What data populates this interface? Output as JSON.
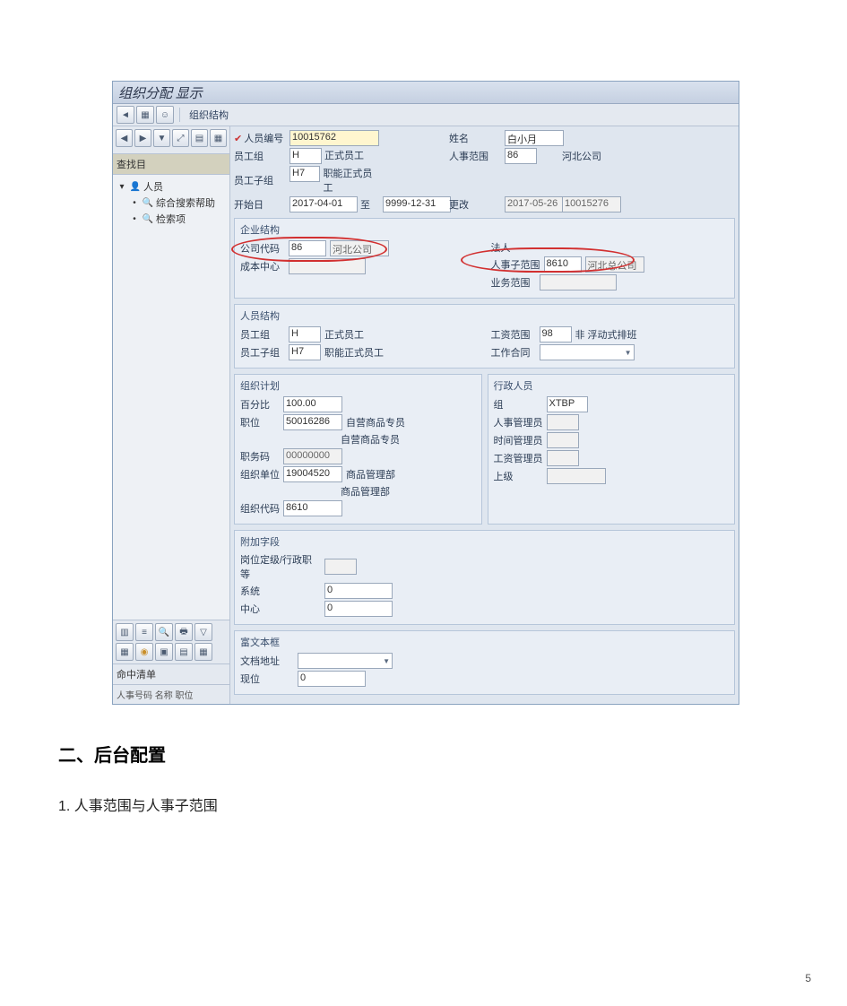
{
  "titlebar": "组织分配 显示",
  "toolbar": {
    "structure": "组织结构"
  },
  "left": {
    "search_title": "查找目",
    "person": "人员",
    "tree_a": "综合搜索帮助",
    "tree_b": "检索项",
    "btm_label": "命中清单",
    "btm_sub": "人事号码 名称 职位"
  },
  "hdr": {
    "person_no_lbl": "人员编号",
    "person_no": "10015762",
    "name_lbl": "姓名",
    "name": "白小月",
    "eggrp_lbl": "员工组",
    "eggrp_code": "H",
    "eggrp_text": "正式员工",
    "area_lbl": "人事范围",
    "area_code": "86",
    "area_text": "河北公司",
    "esub_lbl": "员工子组",
    "esub_code": "H7",
    "esub_text": "职能正式员工",
    "start_lbl": "开始日",
    "start": "2017-04-01",
    "to": "至",
    "end": "9999-12-31",
    "chg_lbl": "更改",
    "chg_date": "2017-05-26",
    "chg_by": "10015276"
  },
  "grp_ent": {
    "title": "企业结构",
    "cocode_lbl": "公司代码",
    "cocode": "86",
    "cocode_text": "河北公司",
    "cost_lbl": "成本中心",
    "legal_lbl": "法人",
    "psub_lbl": "人事子范围",
    "psub": "8610",
    "psub_text": "河北总公司",
    "biz_lbl": "业务范围"
  },
  "grp_pers": {
    "title": "人员结构",
    "eg_lbl": "员工组",
    "eg": "H",
    "eg_text": "正式员工",
    "esg_lbl": "员工子组",
    "esg": "H7",
    "esg_text": "职能正式员工",
    "wfa_lbl": "工资范围",
    "wfa": "98",
    "wfa_text": "非 浮动式排班",
    "contract_lbl": "工作合同"
  },
  "grp_org": {
    "title": "组织计划",
    "pct_lbl": "百分比",
    "pct": "100.00",
    "pos_lbl": "职位",
    "pos": "50016286",
    "pos_text1": "自营商品专员",
    "pos_text2": "自营商品专员",
    "job_lbl": "职务码",
    "job": "00000000",
    "ou_lbl": "组织单位",
    "ou": "19004520",
    "ou_text1": "商品管理部",
    "ou_text2": "商品管理部",
    "okey_lbl": "组织代码",
    "okey": "8610"
  },
  "grp_admin": {
    "title": "行政人员",
    "grp_lbl": "组",
    "grp": "XTBP",
    "hr_lbl": "人事管理员",
    "time_lbl": "时间管理员",
    "pay_lbl": "工资管理员",
    "sup_lbl": "上级"
  },
  "grp_add": {
    "title": "附加字段",
    "lvl_lbl": "岗位定级/行政职等",
    "sys_lbl": "系统",
    "sys": "0",
    "ctr_lbl": "中心",
    "ctr": "0"
  },
  "grp_notes": {
    "title": "富文本框",
    "file_lbl": "文档地址",
    "cur_lbl": "现位",
    "cur": "0"
  },
  "doc": {
    "h2": "二、后台配置",
    "h3": "1.  人事范围与人事子范围",
    "page": "5"
  }
}
